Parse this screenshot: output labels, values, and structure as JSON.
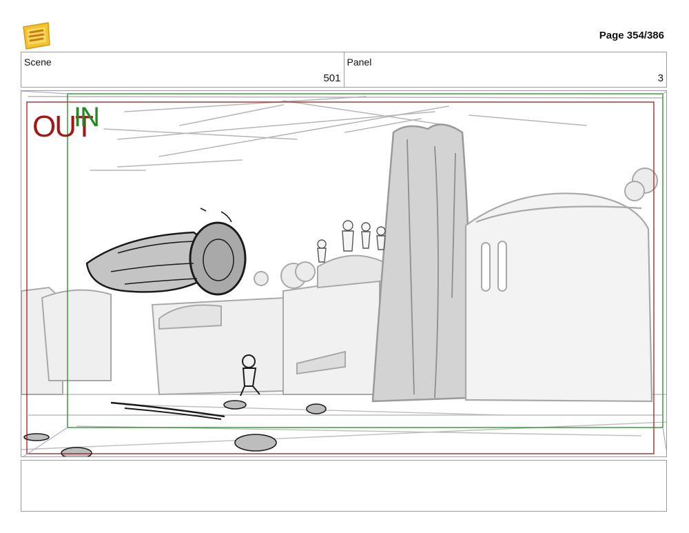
{
  "header": {
    "page_label": "Page 354/386"
  },
  "fields": {
    "scene_label": "Scene",
    "scene_value": "501",
    "panel_label": "Panel",
    "panel_value": "3"
  },
  "frame_marks": {
    "out_label": "OUT",
    "in_label": "IN",
    "out_color": "#a01818",
    "in_color": "#1e8c1e"
  },
  "colors": {
    "border": "#9a9a9a",
    "sketch": "#a8a8a8",
    "ink": "#1a1a1a"
  }
}
